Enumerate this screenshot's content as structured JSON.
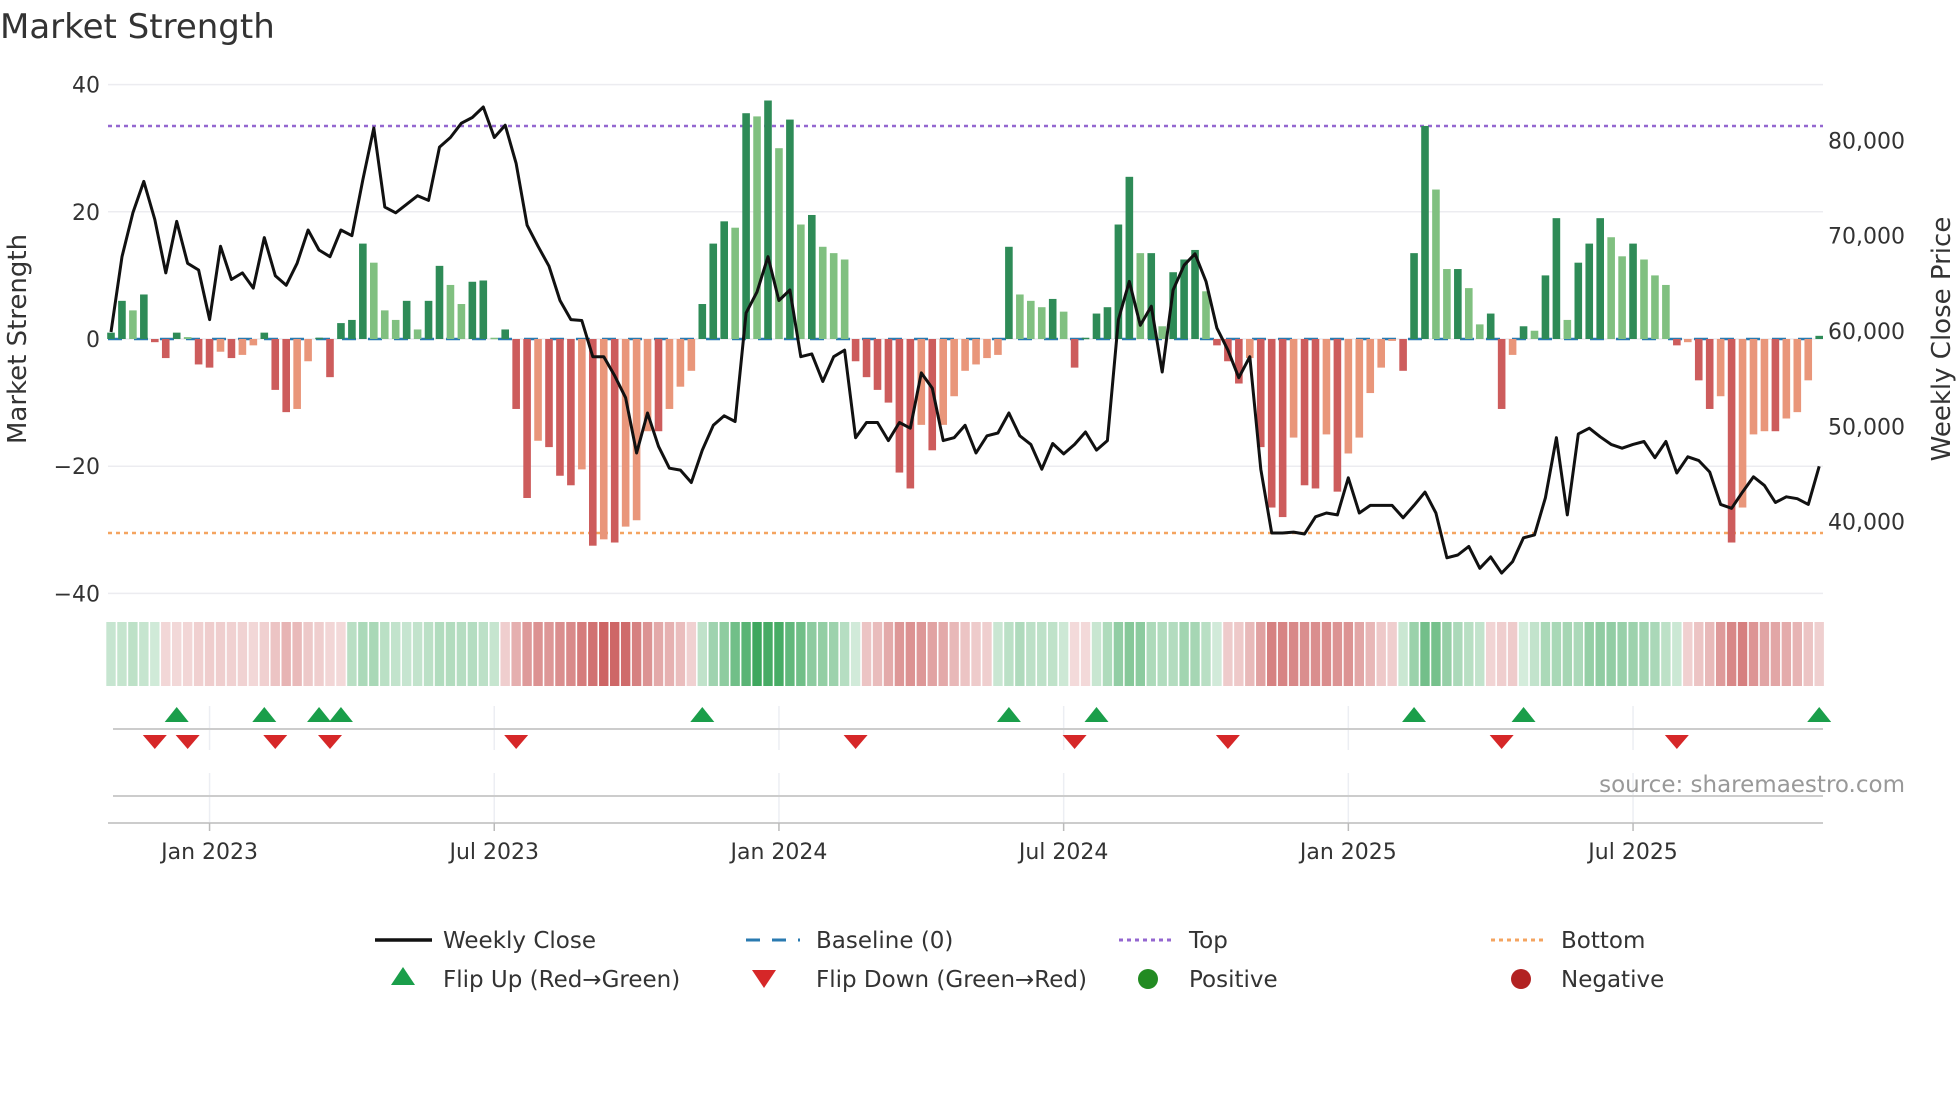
{
  "chart_data": {
    "type": "bar+line",
    "title": "Market Strength",
    "ylabel_left": "Market Strength",
    "ylabel_right": "Weekly Close Price",
    "ylim_left": [
      -40,
      40
    ],
    "ylim_right": [
      30000,
      85000
    ],
    "yticks_left": [
      "40",
      "20",
      "0",
      "−20",
      "−40"
    ],
    "yticks_left_values": [
      40,
      20,
      0,
      -20,
      -40
    ],
    "yticks_right": [
      "80,000",
      "70,000",
      "60,000",
      "50,000",
      "40,000"
    ],
    "yticks_right_values": [
      80000,
      70000,
      60000,
      50000,
      40000
    ],
    "xticks": [
      "Jan 2023",
      "Jul 2023",
      "Jan 2024",
      "Jul 2024",
      "Jan 2025",
      "Jul 2025"
    ],
    "xticks_week_index": [
      9,
      35,
      61,
      87,
      113,
      139
    ],
    "x_interval": "weekly",
    "top_level": 33.5,
    "bottom_level": -30.5,
    "baseline": 0,
    "colors": {
      "strong_pos": "#2e8b57",
      "weak_pos": "#80c080",
      "strong_neg": "#cd5c5c",
      "weak_neg": "#e9967a",
      "close": "#111111",
      "baseline": "#2a7ab0",
      "top": "#9467d0",
      "bottom": "#f4a460",
      "flip_up": "#1a9e4a",
      "flip_down": "#d62728",
      "positive": "#228b22",
      "negative": "#b22222"
    },
    "strength": [
      1,
      6,
      4.5,
      7,
      -0.5,
      -3,
      1,
      0.3,
      -4,
      -4.5,
      -2,
      -3,
      -2.5,
      -1,
      1,
      -8,
      -11.5,
      -11,
      -3.5,
      0.2,
      -6,
      2.5,
      3,
      15,
      12,
      4.5,
      3,
      6,
      1.5,
      6,
      11.5,
      8.5,
      5.5,
      9,
      9.2,
      0.2,
      1.5,
      -11,
      -25,
      -16,
      -17,
      -21.5,
      -23,
      -20.5,
      -32.5,
      -31.5,
      -32,
      -29.5,
      -28.5,
      -14.5,
      -14.5,
      -11,
      -7.5,
      -5,
      5.5,
      15,
      18.5,
      17.5,
      35.5,
      35,
      37.5,
      30,
      34.5,
      18,
      19.5,
      14.5,
      13.5,
      12.5,
      -3.5,
      -6,
      -8,
      -10,
      -21,
      -23.5,
      -13.5,
      -17.5,
      -13.5,
      -9,
      -5,
      -4,
      -3,
      -2.5,
      14.5,
      7,
      6,
      5,
      6.3,
      4.3,
      -4.5,
      0.2,
      4,
      5,
      18,
      25.5,
      13.5,
      13.5,
      2,
      10.5,
      12.5,
      14,
      7.5,
      -1,
      -3.5,
      -7,
      -3,
      -17,
      -26.5,
      -28,
      -15.5,
      -23,
      -23.5,
      -15,
      -24,
      -18,
      -15.5,
      -8.5,
      -4.5,
      -0.3,
      -5,
      13.5,
      33.5,
      23.5,
      11,
      11,
      8,
      2.3,
      4,
      -11,
      -2.5,
      2,
      1.3,
      10,
      19,
      3,
      12,
      15,
      19,
      16,
      13,
      15,
      12.5,
      10,
      8.5,
      -1,
      -0.5,
      -6.5,
      -11,
      -9,
      -32,
      -26.5,
      -15,
      -14.5,
      -14.5,
      -12.5,
      -11.5,
      -6.5,
      0.5
    ],
    "weekly_close": [
      59900,
      67800,
      72400,
      75700,
      71700,
      66100,
      71500,
      67100,
      66400,
      61200,
      68900,
      65400,
      66100,
      64500,
      69800,
      65800,
      64800,
      67100,
      70600,
      68500,
      67800,
      70600,
      70000,
      75900,
      81300,
      73000,
      72400,
      73300,
      74200,
      73700,
      79300,
      80300,
      81800,
      82400,
      83500,
      80300,
      81600,
      77600,
      71100,
      68900,
      66800,
      63200,
      61200,
      61100,
      57300,
      57300,
      55300,
      53000,
      47200,
      51400,
      47900,
      45600,
      45400,
      44100,
      47500,
      50100,
      51100,
      50500,
      61900,
      64100,
      67800,
      63200,
      64300,
      57300,
      57600,
      54700,
      57300,
      58000,
      48800,
      50400,
      50400,
      48500,
      50400,
      49800,
      55600,
      54000,
      48500,
      48800,
      50100,
      47200,
      49000,
      49300,
      51400,
      49000,
      48100,
      45500,
      48200,
      47100,
      48100,
      49400,
      47500,
      48500,
      61200,
      65200,
      60600,
      62600,
      55700,
      64300,
      66900,
      68100,
      65200,
      60300,
      58000,
      55100,
      57300,
      45500,
      38800,
      38800,
      38900,
      38700,
      40500,
      40900,
      40700,
      44600,
      40900,
      41700,
      41700,
      41700,
      40400,
      41700,
      43100,
      40900,
      36200,
      36500,
      37400,
      35100,
      36300,
      34600,
      35800,
      38300,
      38600,
      42500,
      48800,
      40700,
      49200,
      49800,
      48900,
      48100,
      47700,
      48100,
      48400,
      46700,
      48400,
      45100,
      46800,
      46400,
      45200,
      41800,
      41400,
      43100,
      44700,
      43800,
      42000,
      42600,
      42400,
      41800,
      45800
    ],
    "flip_up_week_index": [
      6,
      14,
      19,
      21,
      54,
      82,
      90,
      119,
      129,
      156
    ],
    "flip_down_week_index": [
      4,
      7,
      15,
      20,
      37,
      68,
      88,
      102,
      127,
      143
    ],
    "legend": {
      "weekly_close": "Weekly Close",
      "baseline": "Baseline (0)",
      "top": "Top",
      "bottom": "Bottom",
      "flip_up": "Flip Up (Red→Green)",
      "flip_down": "Flip Down (Green→Red)",
      "positive": "Positive",
      "negative": "Negative"
    },
    "legend_position": "bottom-center",
    "source": "source: sharemaestro.com"
  }
}
